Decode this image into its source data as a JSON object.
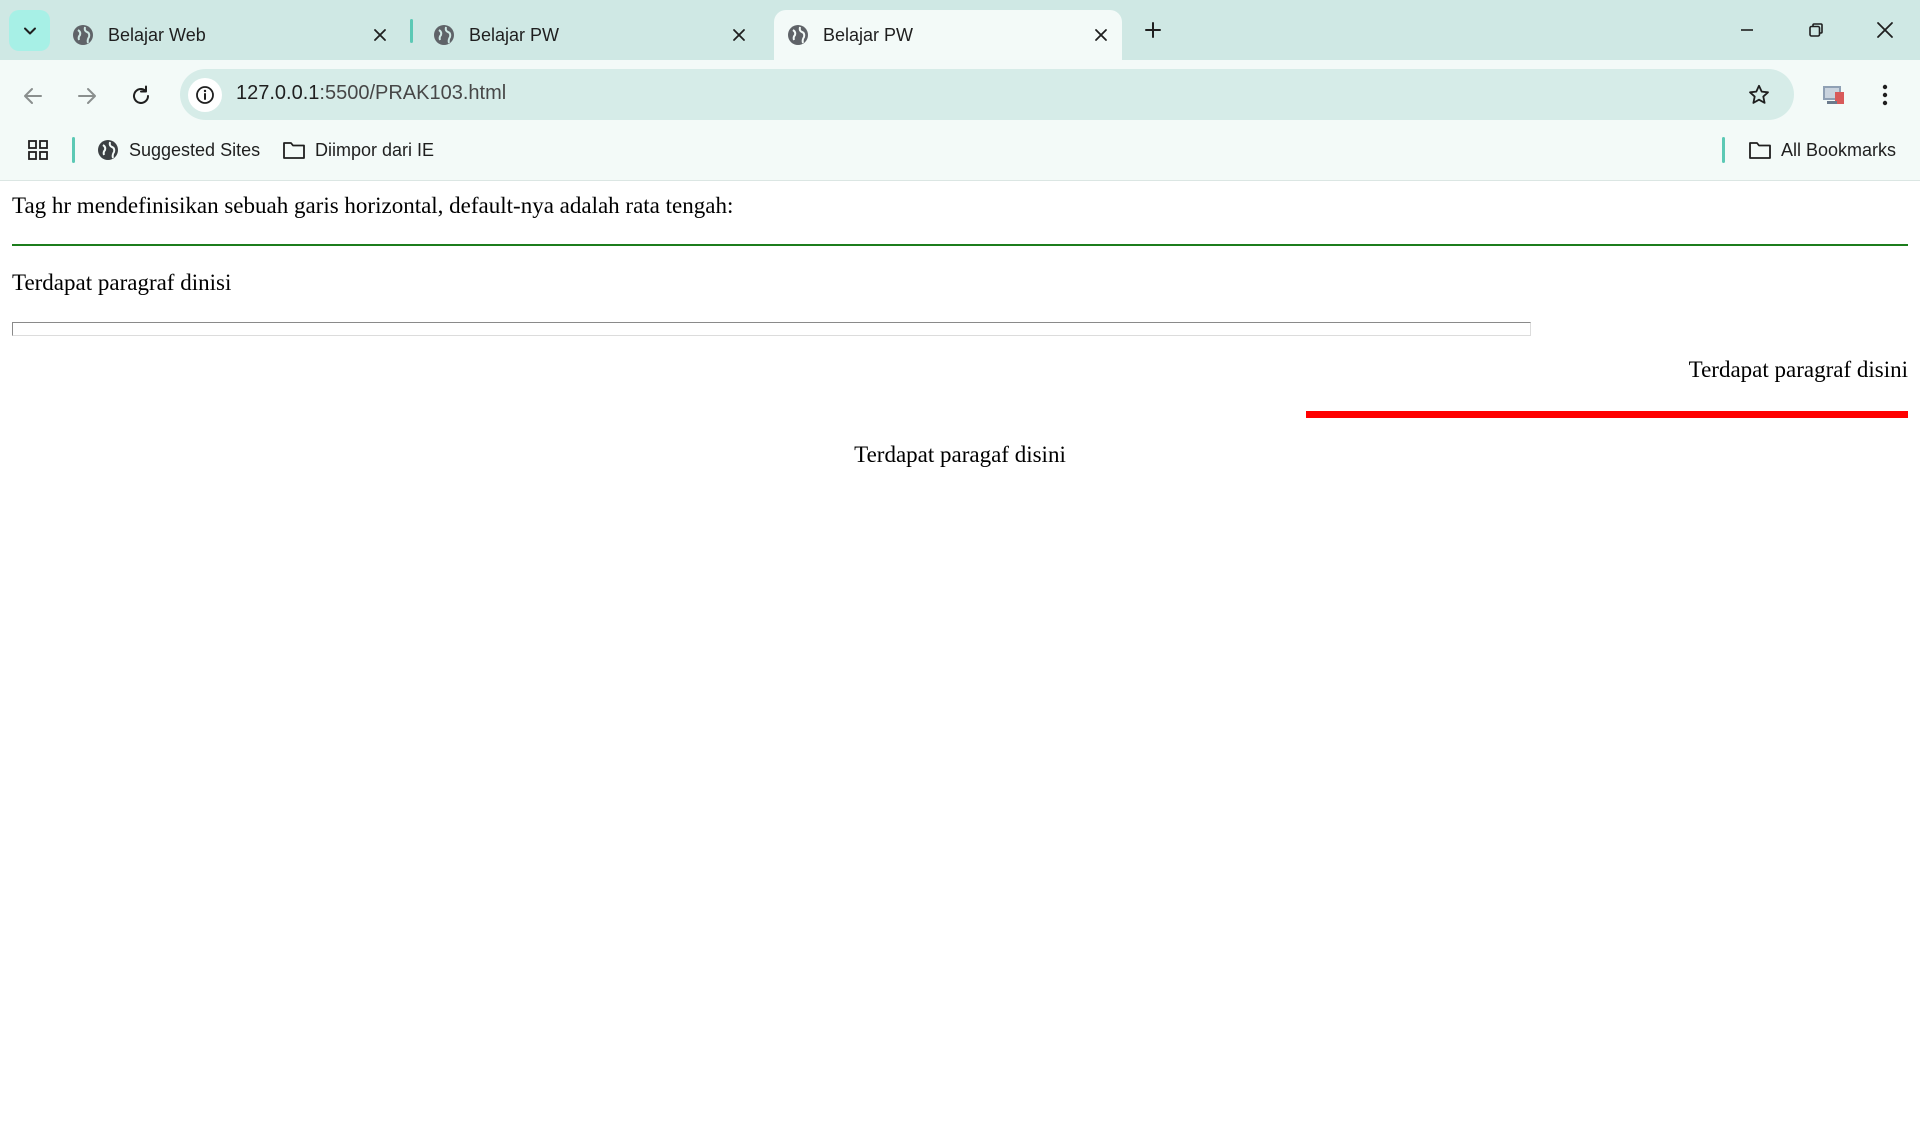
{
  "browser": {
    "tabs": [
      {
        "title": "Belajar Web",
        "active": false
      },
      {
        "title": "Belajar PW",
        "active": false
      },
      {
        "title": "Belajar PW",
        "active": true
      }
    ],
    "address": {
      "host": "127.0.0.1",
      "path": ":5500/PRAK103.html"
    },
    "bookmarks": {
      "items": [
        {
          "label": "Suggested Sites",
          "icon": "globe-icon"
        },
        {
          "label": "Diimpor dari IE",
          "icon": "folder-icon"
        }
      ],
      "all_bookmarks": "All Bookmarks"
    },
    "colors": {
      "tabstrip_bg": "#cfe8e4",
      "toolbar_bg": "#f3faf8",
      "accent": "#5cc9b5"
    }
  },
  "page": {
    "paragraph1": "Tag hr mendefinisikan sebuah garis horizontal, default-nya adalah rata tengah:",
    "paragraph2": "Terdapat paragraf dinisi",
    "paragraph3": "Terdapat paragraf disini",
    "paragraph4": "Terdapat paragaf disini",
    "hr_colors": {
      "green": "#1c7d1c",
      "red": "#ff0000"
    }
  }
}
